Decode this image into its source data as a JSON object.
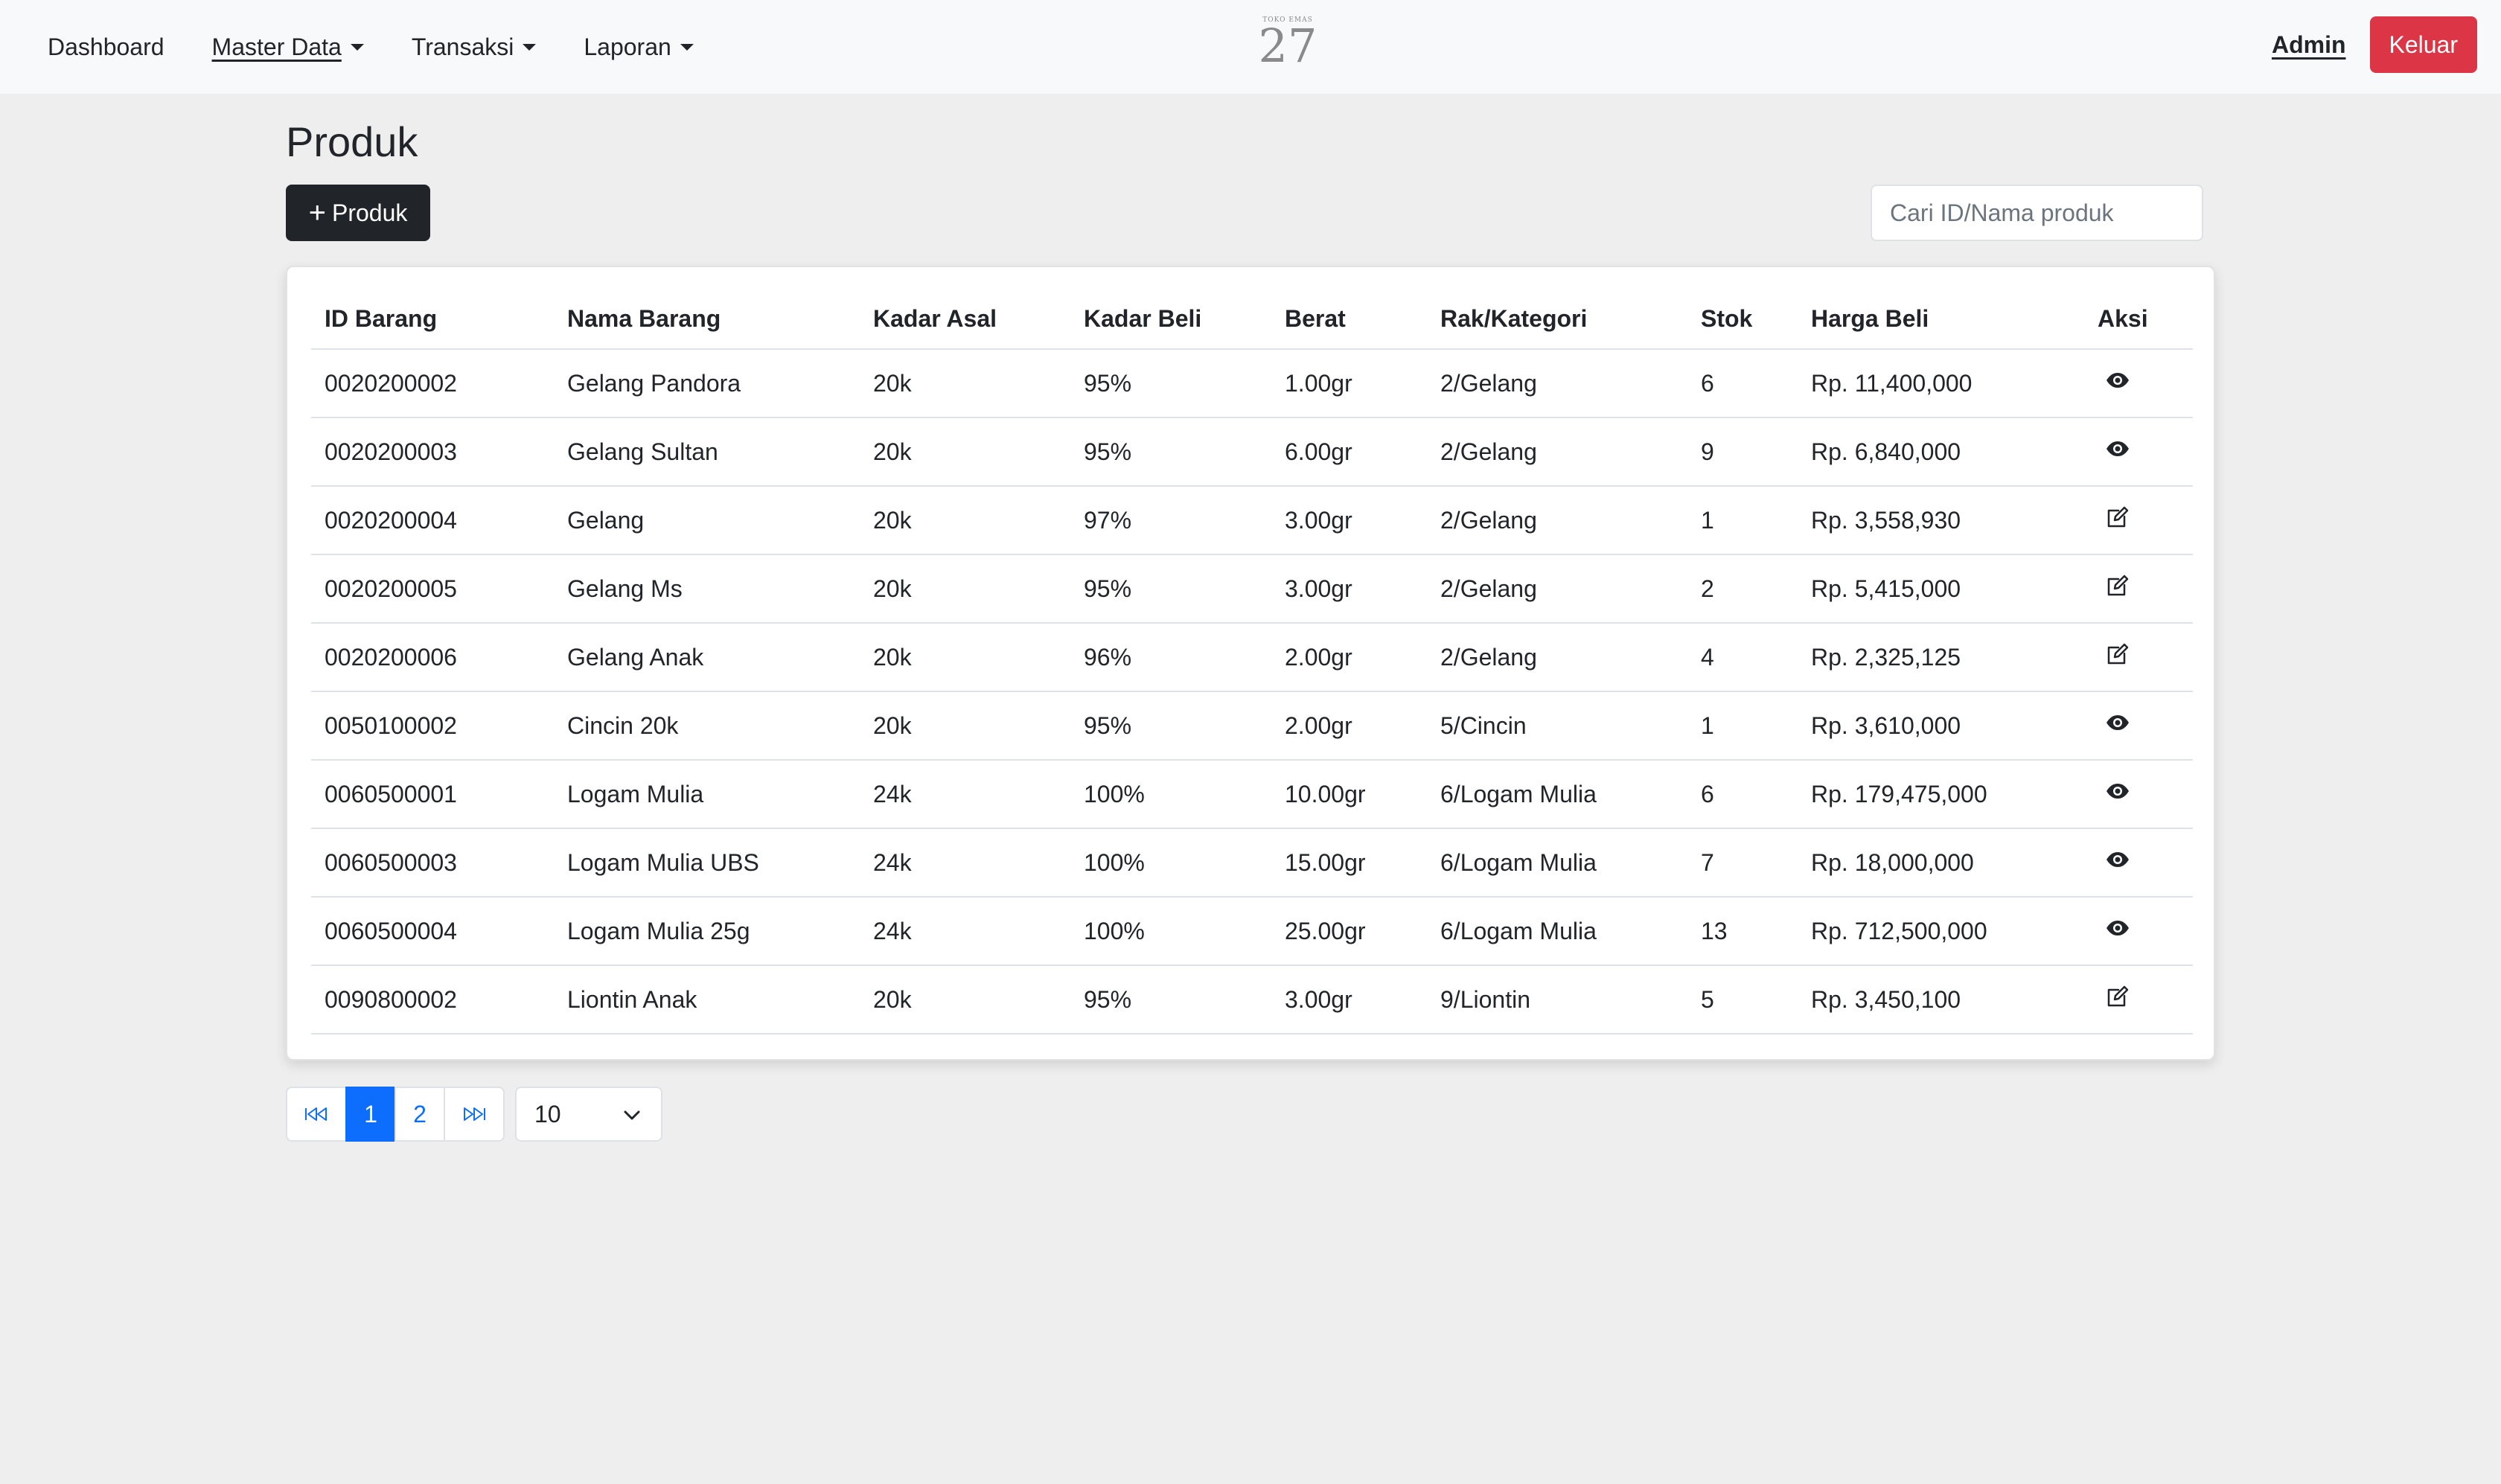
{
  "navbar": {
    "items": [
      {
        "label": "Dashboard",
        "dropdown": false
      },
      {
        "label": "Master Data",
        "dropdown": true
      },
      {
        "label": "Transaksi",
        "dropdown": true
      },
      {
        "label": "Laporan",
        "dropdown": true
      }
    ],
    "logo": {
      "small_text": "TOKO EMAS",
      "number": "27"
    },
    "user": "Admin",
    "logout_label": "Keluar"
  },
  "page": {
    "title": "Produk",
    "add_button_label": "Produk",
    "search_placeholder": "Cari ID/Nama produk"
  },
  "table": {
    "headers": [
      "ID Barang",
      "Nama Barang",
      "Kadar Asal",
      "Kadar Beli",
      "Berat",
      "Rak/Kategori",
      "Stok",
      "Harga Beli",
      "Aksi"
    ],
    "rows": [
      {
        "id": "0020200002",
        "nama": "Gelang Pandora",
        "kadar_asal": "20k",
        "kadar_beli": "95%",
        "berat": "1.00gr",
        "rak": "2/Gelang",
        "stok": "6",
        "harga": "Rp. 11,400,000",
        "action": "eye-icon"
      },
      {
        "id": "0020200003",
        "nama": "Gelang Sultan",
        "kadar_asal": "20k",
        "kadar_beli": "95%",
        "berat": "6.00gr",
        "rak": "2/Gelang",
        "stok": "9",
        "harga": "Rp. 6,840,000",
        "action": "eye-icon"
      },
      {
        "id": "0020200004",
        "nama": "Gelang",
        "kadar_asal": "20k",
        "kadar_beli": "97%",
        "berat": "3.00gr",
        "rak": "2/Gelang",
        "stok": "1",
        "harga": "Rp. 3,558,930",
        "action": "edit-icon"
      },
      {
        "id": "0020200005",
        "nama": "Gelang Ms",
        "kadar_asal": "20k",
        "kadar_beli": "95%",
        "berat": "3.00gr",
        "rak": "2/Gelang",
        "stok": "2",
        "harga": "Rp. 5,415,000",
        "action": "edit-icon"
      },
      {
        "id": "0020200006",
        "nama": "Gelang Anak",
        "kadar_asal": "20k",
        "kadar_beli": "96%",
        "berat": "2.00gr",
        "rak": "2/Gelang",
        "stok": "4",
        "harga": "Rp. 2,325,125",
        "action": "edit-icon"
      },
      {
        "id": "0050100002",
        "nama": "Cincin 20k",
        "kadar_asal": "20k",
        "kadar_beli": "95%",
        "berat": "2.00gr",
        "rak": "5/Cincin",
        "stok": "1",
        "harga": "Rp. 3,610,000",
        "action": "eye-icon"
      },
      {
        "id": "0060500001",
        "nama": "Logam Mulia",
        "kadar_asal": "24k",
        "kadar_beli": "100%",
        "berat": "10.00gr",
        "rak": "6/Logam Mulia",
        "stok": "6",
        "harga": "Rp. 179,475,000",
        "action": "eye-icon"
      },
      {
        "id": "0060500003",
        "nama": "Logam Mulia UBS",
        "kadar_asal": "24k",
        "kadar_beli": "100%",
        "berat": "15.00gr",
        "rak": "6/Logam Mulia",
        "stok": "7",
        "harga": "Rp. 18,000,000",
        "action": "eye-icon"
      },
      {
        "id": "0060500004",
        "nama": "Logam Mulia 25g",
        "kadar_asal": "24k",
        "kadar_beli": "100%",
        "berat": "25.00gr",
        "rak": "6/Logam Mulia",
        "stok": "13",
        "harga": "Rp. 712,500,000",
        "action": "eye-icon"
      },
      {
        "id": "0090800002",
        "nama": "Liontin Anak",
        "kadar_asal": "20k",
        "kadar_beli": "95%",
        "berat": "3.00gr",
        "rak": "9/Liontin",
        "stok": "5",
        "harga": "Rp. 3,450,100",
        "action": "edit-icon"
      }
    ]
  },
  "pagination": {
    "pages": [
      "1",
      "2"
    ],
    "current": "1",
    "per_page": "10"
  },
  "colors": {
    "primary": "#0d6efd",
    "danger": "#dc3545",
    "dark": "#212529",
    "background": "#eeeeee"
  }
}
